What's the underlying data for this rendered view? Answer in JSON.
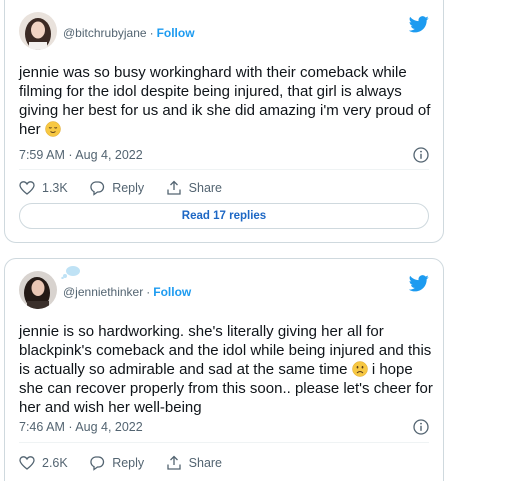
{
  "tweets": [
    {
      "handle": "@bitchrubyjane",
      "separator": "·",
      "follow_label": "Follow",
      "text": "jennie was so busy workinghard with their comeback while filming for the idol despite being injured, that girl is always giving her best for us and ik she did amazing i'm very proud of her",
      "emoji": "relieved-face",
      "timestamp": "7:59 AM · Aug 4, 2022",
      "likes": "1.3K",
      "reply_label": "Reply",
      "share_label": "Share",
      "read_replies": "Read 17 replies"
    },
    {
      "handle": "@jenniethinker",
      "separator": "·",
      "follow_label": "Follow",
      "text_part1": "jennie is so hardworking. she's literally giving her all for blackpink's comeback and the idol while being injured and this is actually so admirable and sad at the same time",
      "emoji": "frowning-face",
      "text_part2": "i hope she can recover properly from this soon.. please let's cheer for her and wish her well-being",
      "timestamp": "7:46 AM · Aug 4, 2022",
      "likes": "2.6K",
      "reply_label": "Reply",
      "share_label": "Share"
    }
  ],
  "colors": {
    "twitter_blue": "#1d9bf0",
    "link_blue": "#1d67c4",
    "muted": "#536471",
    "border": "#cfd9de"
  },
  "icons": [
    "twitter-logo-icon",
    "heart-icon",
    "reply-icon",
    "share-icon",
    "info-icon"
  ]
}
